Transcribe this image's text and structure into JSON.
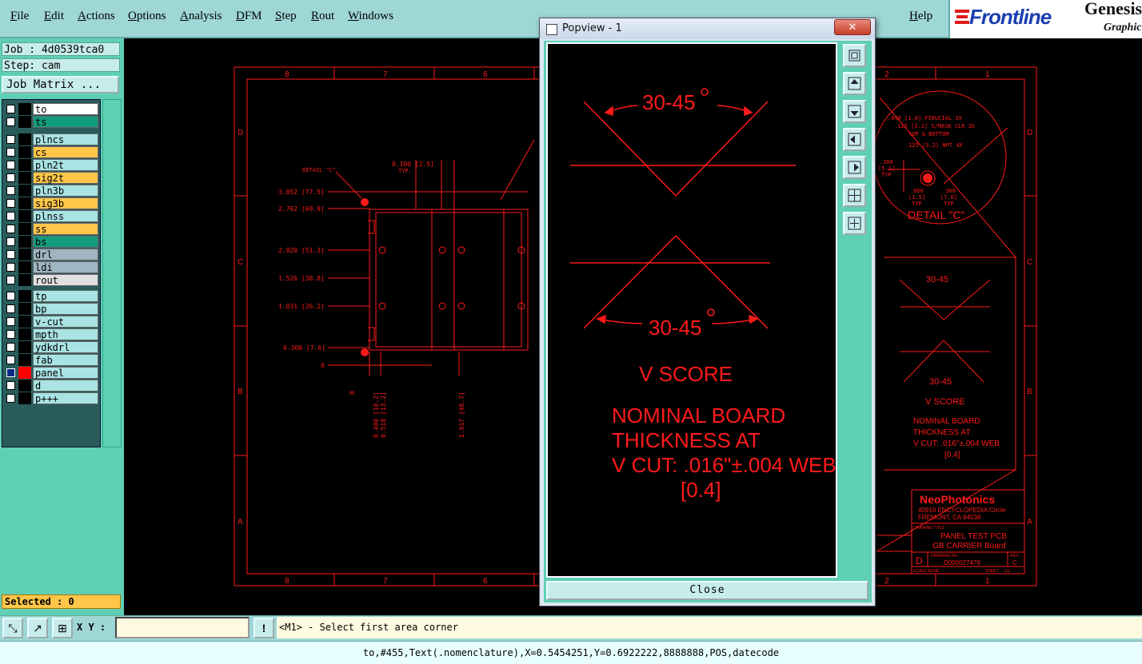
{
  "menu": {
    "items": [
      "File",
      "Edit",
      "Actions",
      "Options",
      "Analysis",
      "DFM",
      "Step",
      "Rout",
      "Windows"
    ],
    "help": "Help"
  },
  "logo": {
    "brand": "Frontline",
    "product": "Genesis",
    "subtitle": "Graphic"
  },
  "job": {
    "job_label": "Job : 4d0539tca0",
    "step_label": "Step: cam",
    "matrix_button": "Job Matrix ..."
  },
  "layers": [
    {
      "name": "to",
      "color": "#ffffff",
      "swatch": "#000000"
    },
    {
      "name": "ts",
      "color": "#129c7e",
      "swatch": "#000000"
    },
    {
      "name": "plncs",
      "color": "#a9e3e3",
      "swatch": "#000000"
    },
    {
      "name": "cs",
      "color": "#ffc64a",
      "swatch": "#000000"
    },
    {
      "name": "pln2t",
      "color": "#a9e3e3",
      "swatch": "#000000"
    },
    {
      "name": "sig2t",
      "color": "#ffc64a",
      "swatch": "#000000"
    },
    {
      "name": "pln3b",
      "color": "#a9e3e3",
      "swatch": "#000000"
    },
    {
      "name": "sig3b",
      "color": "#ffc64a",
      "swatch": "#000000"
    },
    {
      "name": "plnss",
      "color": "#a9e3e3",
      "swatch": "#000000"
    },
    {
      "name": "ss",
      "color": "#ffc64a",
      "swatch": "#000000"
    },
    {
      "name": "bs",
      "color": "#129c7e",
      "swatch": "#000000"
    },
    {
      "name": "drl",
      "color": "#9fb6c2",
      "swatch": "#000000"
    },
    {
      "name": "ldi",
      "color": "#9fb6c2",
      "swatch": "#000000"
    },
    {
      "name": "rout",
      "color": "#e0e0e0",
      "swatch": "#000000"
    },
    {
      "name": "tp",
      "color": "#a9e3e3",
      "swatch": "#000000"
    },
    {
      "name": "bp",
      "color": "#a9e3e3",
      "swatch": "#000000"
    },
    {
      "name": "v-cut",
      "color": "#a9e3e3",
      "swatch": "#000000"
    },
    {
      "name": "mpth",
      "color": "#a9e3e3",
      "swatch": "#000000"
    },
    {
      "name": "ydkdrl",
      "color": "#a9e3e3",
      "swatch": "#000000"
    },
    {
      "name": "fab",
      "color": "#a9e3e3",
      "swatch": "#000000"
    },
    {
      "name": "panel",
      "color": "#a9e3e3",
      "swatch": "#ff0000",
      "active": true
    },
    {
      "name": "d",
      "color": "#a9e3e3",
      "swatch": "#000000"
    },
    {
      "name": "p+++",
      "color": "#a9e3e3",
      "swatch": "#000000"
    }
  ],
  "selected": "Selected : 0",
  "cmd": {
    "xy_label": "X Y :",
    "xy_value": "",
    "prompt": "<M1> - Select first area corner"
  },
  "status": "to,#455,Text(.nomenclature),X=0.5454251,Y=0.6922222,8888888,POS,datecode",
  "popview": {
    "title": "Popview - 1",
    "close_label": "Close",
    "angle_top": "30-45",
    "angle_bottom": "30-45",
    "v_score": "V SCORE",
    "note_lines": [
      "NOMINAL BOARD",
      "THICKNESS AT",
      "V CUT: .016\"±.004 WEB",
      "[0.4]"
    ]
  },
  "drawing": {
    "col_labels": [
      "8",
      "7",
      "6",
      "2",
      "1"
    ],
    "row_labels": [
      "D",
      "C",
      "B",
      "A"
    ],
    "dims_left": [
      "3.052  [77.5]",
      "2.762  [69.9]",
      "2.020  [51.3]",
      "1.526  [38.8]",
      "1.031  [26.2]",
      "0.300  [7.6]",
      "0"
    ],
    "detail_c_callout": "DETAIL \"C\"",
    "dim_top": "0.100  [2.5]",
    "dim_top_sub": "TYP.",
    "dims_bottom": [
      "0",
      "0.400 [10.2]",
      "0.518 [13.2]",
      "1.917 [48.7]"
    ],
    "detail_c_title": "DETAIL \"C\"",
    "detail_c_notes": [
      ".040 [1.0] FIDUCIAL 3X",
      ".125 [3.2] S/MASK CLR 3X",
      "TOP & BOTTOM",
      ".125 [3.2] NPT 4X"
    ],
    "detail_c_dims": [
      ".200",
      "[5.1]",
      "TYP",
      ".060",
      "[1.5]",
      "TYP",
      ".300",
      "[7.6]",
      "TYP"
    ],
    "mini_angle_top": "30-45",
    "mini_angle_bottom": "30-45",
    "mini_v_score": "V SCORE",
    "mini_note_lines": [
      "NOMINAL BOARD",
      "THICKNESS AT",
      "V CUT: .016\"±.004 WEB",
      "[0.4]"
    ],
    "company": "NeoPhotonics",
    "address_1": "40919 ENCYCLOPEDIA Circle",
    "address_2": "FREMONT, CA 94538",
    "drawing_title_label": "DRAWING TITLE",
    "title_1": "PANEL TEST PCB",
    "title_2": "GB CARRIER Board",
    "size_letter": "D",
    "drawing_no_label": "DRAWING NO.",
    "drawing_no": "D000027478",
    "rev_label": "REV",
    "rev": "C",
    "sheet_label": "SHEET",
    "sheet": "1/1",
    "scale_label": "SCALE",
    "scale": "NONE"
  },
  "colors": {
    "cad_red": "#ff1a1a",
    "panel_teal": "#5fcfb5",
    "menu_bg": "#9fd6d6"
  }
}
